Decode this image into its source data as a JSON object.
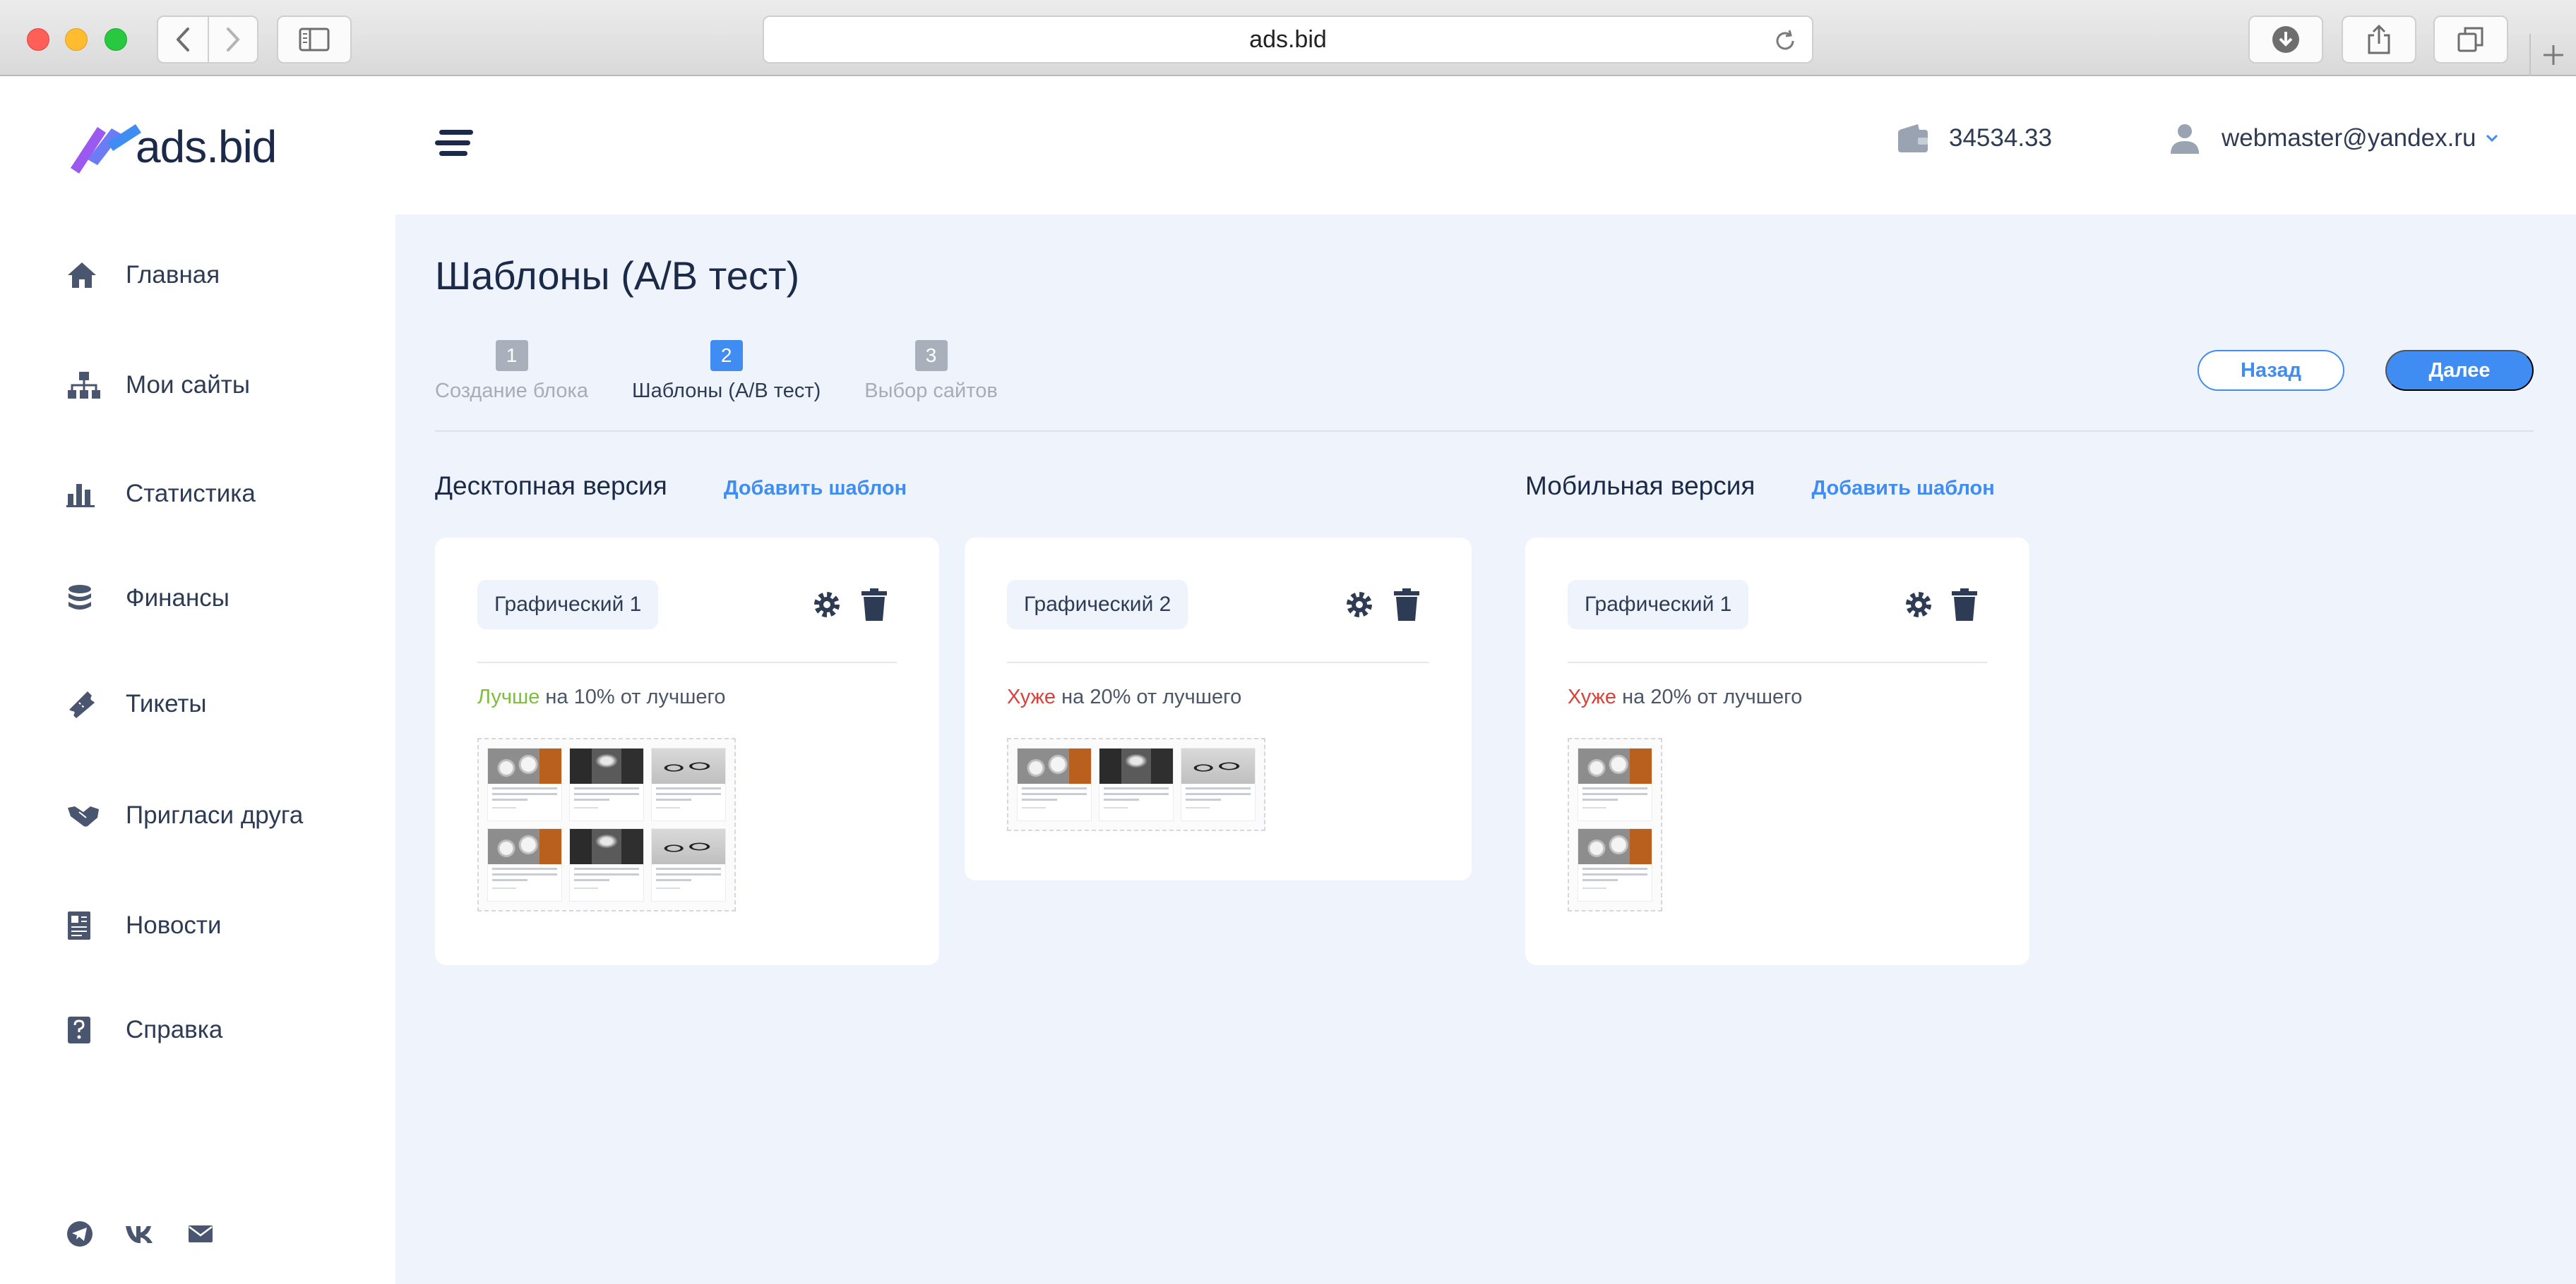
{
  "browser": {
    "url": "ads.bid"
  },
  "app": {
    "logo_text": "ads.bid"
  },
  "sidebar": {
    "items": [
      {
        "label": "Главная",
        "icon": "home-icon"
      },
      {
        "label": "Мои сайты",
        "icon": "sitemap-icon"
      },
      {
        "label": "Статистика",
        "icon": "bar-chart-icon"
      },
      {
        "label": "Финансы",
        "icon": "coins-icon"
      },
      {
        "label": "Тикеты",
        "icon": "ticket-icon"
      },
      {
        "label": "Пригласи друга",
        "icon": "handshake-icon"
      },
      {
        "label": "Новости",
        "icon": "newspaper-icon"
      },
      {
        "label": "Справка",
        "icon": "help-icon"
      }
    ],
    "socials": [
      "telegram-icon",
      "vk-icon",
      "mail-icon"
    ]
  },
  "header": {
    "balance": "34534.33",
    "user_email": "webmaster@yandex.ru"
  },
  "page": {
    "title": "Шаблоны (A/B тест)",
    "steps": [
      {
        "num": "1",
        "label": "Создание блока",
        "active": false
      },
      {
        "num": "2",
        "label": "Шаблоны (A/B тест)",
        "active": true
      },
      {
        "num": "3",
        "label": "Выбор сайтов",
        "active": false
      }
    ],
    "back_label": "Назад",
    "next_label": "Далее"
  },
  "desktop": {
    "title": "Десктопная версия",
    "add_label": "Добавить шаблон",
    "cards": [
      {
        "name": "Графический 1",
        "perf_word": "Лучше",
        "perf_rest": " на 10% от лучшего",
        "status": "good"
      },
      {
        "name": "Графический 2",
        "perf_word": "Хуже",
        "perf_rest": " на 20% от лучшего",
        "status": "bad"
      }
    ]
  },
  "mobile": {
    "title": "Мобильная версия",
    "add_label": "Добавить шаблон",
    "cards": [
      {
        "name": "Графический 1",
        "perf_word": "Хуже",
        "perf_rest": " на 20% от лучшего",
        "status": "bad"
      }
    ]
  },
  "colors": {
    "accent": "#3f8cf2",
    "good": "#7cbf3c",
    "bad": "#d6433b",
    "background": "#eff3fc",
    "text": "#2e3b55"
  }
}
